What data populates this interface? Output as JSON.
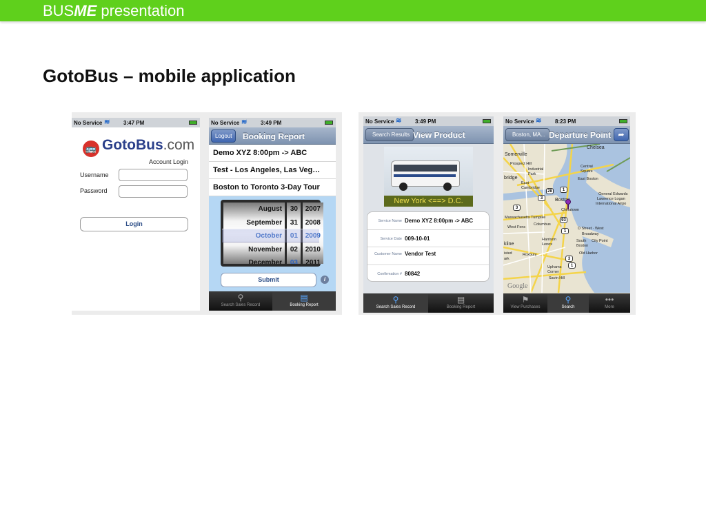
{
  "header": {
    "brand_prefix": "BUS",
    "brand_emph": "ME",
    "brand_suffix": " presentation",
    "color": "#5fd01c"
  },
  "title": "GotoBus – mobile application",
  "status": {
    "carrier": "No Service",
    "time_login": "3:47 PM",
    "time_booking": "3:49 PM",
    "time_product": "3:49 PM",
    "time_map": "8:23 PM"
  },
  "login_screen": {
    "logo_main": "GotoBus",
    "logo_suffix": ".com",
    "account_login": "Account Login",
    "username_label": "Username",
    "password_label": "Password",
    "login_button": "Login"
  },
  "booking_screen": {
    "logout_button": "Logout",
    "nav_title": "Booking Report",
    "rows": [
      "Demo XYZ 8:00pm -> ABC",
      "Test - Los Angeles, Las Veg…",
      "Boston to Toronto 3-Day Tour"
    ],
    "months": [
      "August",
      "September",
      "October",
      "November",
      "December"
    ],
    "days": [
      "30",
      "31",
      "01",
      "02",
      "03"
    ],
    "years": [
      "2007",
      "2008",
      "2009",
      "2010",
      "2011"
    ],
    "submit_button": "Submit",
    "info_icon": "i",
    "tabs": [
      "Search Sales Record",
      "Booking Report"
    ]
  },
  "product_screen": {
    "back_button": "Search Results",
    "nav_title": "View Product",
    "image_caption": "New York <==> D.C.",
    "details": [
      {
        "key": "Service Name",
        "value": "Demo XYZ 8:00pm -> ABC"
      },
      {
        "key": "Service Date",
        "value": "009-10-01"
      },
      {
        "key": "Customer Name",
        "value": "Vendor Test"
      },
      {
        "key": "Confirmation #",
        "value": "80842"
      }
    ],
    "tabs": [
      "Search Sales Record",
      "Booking Report"
    ]
  },
  "map_screen": {
    "back_button": "Boston, MA...",
    "nav_title": "Departure Point",
    "labels": {
      "chelsea": "Chelsea",
      "somerville": "Somerville",
      "prospect_hill": "Prospect Hill",
      "industrial_park": "Industrial Park",
      "central_square": "Central Square",
      "bridge": "bridge",
      "east_cambridge": "East Cambridge",
      "east_boston": "East Boston",
      "boston": "Boston",
      "general_edwards": "General Edwards",
      "lawrence_logan": "Lawrence Logan",
      "intl_airport": "International Airpo",
      "mass_pike": "Massachusetts Turnpike",
      "columbus": "Columbus",
      "west_fens": "West Fens",
      "d_street": "D Street · West",
      "broadway": "Broadway",
      "chinatown": "Chinatown",
      "kline": "kline",
      "harrison_lenox": "Harrison Lenox",
      "south_boston": "South Boston",
      "city_point": "City Point",
      "roxbury": "Roxbury",
      "old_harbor": "Old Harbor",
      "uphams_corner": "Uphams Corner",
      "savin_hill": "Savin Hill",
      "ark": "ark",
      "isted": "isted",
      "google": "Google"
    },
    "shields": [
      "28",
      "1",
      "3",
      "3",
      "93",
      "1",
      "3",
      "1"
    ],
    "tabs": [
      "View Purchases",
      "Search",
      "More"
    ]
  }
}
